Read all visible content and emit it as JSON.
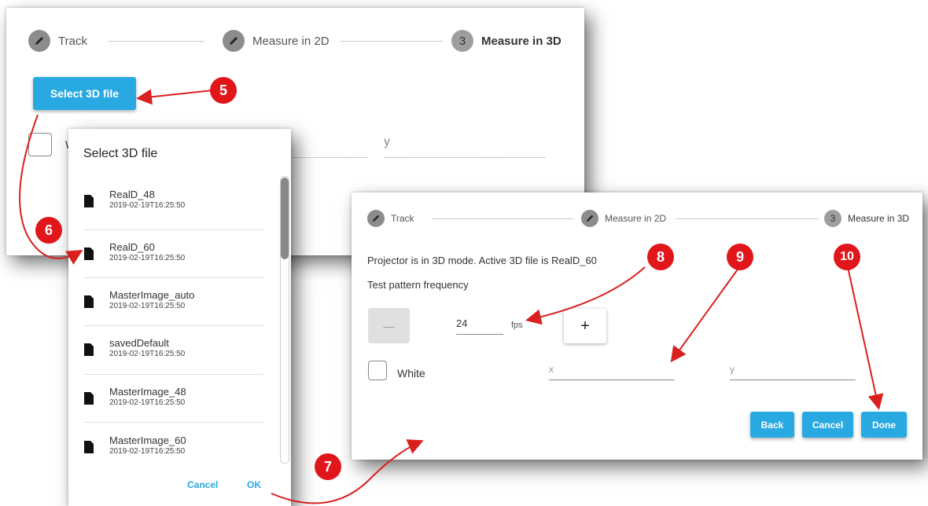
{
  "panel1": {
    "steps": [
      {
        "label": "Track",
        "icon": "pencil-icon"
      },
      {
        "label": "Measure in 2D",
        "icon": "pencil-icon"
      },
      {
        "num": "3",
        "label": "Measure in 3D"
      }
    ],
    "select_button": "Select 3D file",
    "checkbox_label": "W",
    "y_placeholder": "y"
  },
  "dialog": {
    "title": "Select 3D file",
    "files": [
      {
        "name": "RealD_48",
        "date": "2019-02-19T16:25:50"
      },
      {
        "name": "RealD_60",
        "date": "2019-02-19T16:25:50"
      },
      {
        "name": "MasterImage_auto",
        "date": "2019-02-19T16:25:50"
      },
      {
        "name": "savedDefault",
        "date": "2019-02-19T16:25:50"
      },
      {
        "name": "MasterImage_48",
        "date": "2019-02-19T16:25:50"
      },
      {
        "name": "MasterImage_60",
        "date": "2019-02-19T16:25:50"
      }
    ],
    "cancel": "Cancel",
    "ok": "OK"
  },
  "panel2": {
    "steps": [
      {
        "label": "Track",
        "icon": "pencil-icon"
      },
      {
        "label": "Measure in 2D",
        "icon": "pencil-icon"
      },
      {
        "num": "3",
        "label": "Measure in 3D"
      }
    ],
    "status_text": "Projector is in 3D mode. Active 3D file is RealD_60",
    "frequency_label": "Test pattern frequency",
    "minus": "—",
    "fps_value": "24",
    "fps_unit": "fps",
    "plus": "+",
    "white_label": "White",
    "x_placeholder": "x",
    "y_placeholder": "y",
    "back": "Back",
    "cancel": "Cancel",
    "done": "Done"
  },
  "markers": [
    "5",
    "6",
    "7",
    "8",
    "9",
    "10"
  ],
  "colors": {
    "accent": "#29a9e1",
    "marker": "#e0161b",
    "arrow": "#d9201e"
  }
}
